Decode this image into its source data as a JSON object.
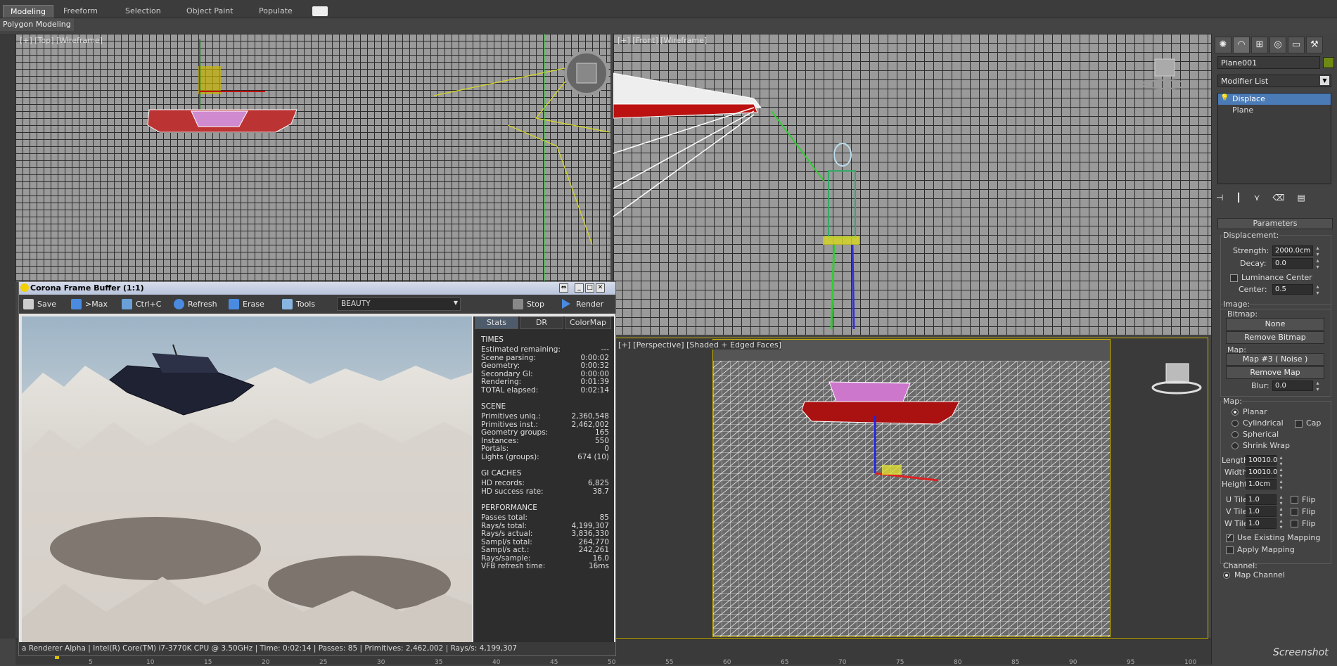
{
  "ribbon": {
    "tabs": [
      {
        "label": "Modeling"
      },
      {
        "label": "Freeform"
      },
      {
        "label": "Selection"
      },
      {
        "label": "Object Paint"
      },
      {
        "label": "Populate"
      }
    ],
    "subtab": "Polygon Modeling"
  },
  "viewports": {
    "top_label": "[+] [Top] [Wireframe]",
    "front_label": "[+] [Front] [Wireframe]",
    "persp_label": "[+] [Perspective] [Shaded + Edged Faces]",
    "viewcube_front": "FRONT",
    "viewcube_persp": "Front"
  },
  "command_panel": {
    "object_name": "Plane001",
    "object_color": "#6f8a12",
    "modifier_list": "Modifier List",
    "stack": [
      "Displace",
      "Plane"
    ],
    "rollout_title": "Parameters",
    "displacement": {
      "title": "Displacement:",
      "strength_label": "Strength:",
      "strength": "2000.0cm",
      "decay_label": "Decay:",
      "decay": "0.0",
      "luminance_center": "Luminance Center",
      "center_label": "Center:",
      "center": "0.5"
    },
    "image": {
      "title": "Image:",
      "bitmap_label": "Bitmap:",
      "bitmap_btn": "None",
      "remove_bitmap": "Remove Bitmap",
      "map_label": "Map:",
      "map_btn": "Map #3 ( Noise )",
      "remove_map": "Remove Map",
      "blur_label": "Blur:",
      "blur": "0.0"
    },
    "map": {
      "title": "Map:",
      "planar": "Planar",
      "cylindrical": "Cylindrical",
      "cap": "Cap",
      "spherical": "Spherical",
      "shrink_wrap": "Shrink Wrap",
      "length_label": "Length:",
      "length": "10010.0",
      "width_label": "Width:",
      "width": "10010.0",
      "height_label": "Height:",
      "height": "1.0cm",
      "utile_label": "U Tile:",
      "utile": "1.0",
      "vtile_label": "V Tile:",
      "vtile": "1.0",
      "wtile_label": "W Tile:",
      "wtile": "1.0",
      "flip": "Flip",
      "use_existing": "Use Existing Mapping",
      "apply_mapping": "Apply Mapping"
    },
    "channel": {
      "title": "Channel:",
      "map_channel": "Map Channel"
    }
  },
  "frame_buffer": {
    "title": "Corona Frame Buffer (1:1)",
    "toolbar": {
      "save": "Save",
      "max": ">Max",
      "ctrlc": "Ctrl+C",
      "refresh": "Refresh",
      "erase": "Erase",
      "tools": "Tools",
      "pass": "BEAUTY",
      "stop": "Stop",
      "render": "Render"
    },
    "stats_tabs": [
      "Stats",
      "DR",
      "ColorMap"
    ],
    "times": {
      "title": "TIMES",
      "rows": [
        {
          "k": "Estimated remaining:",
          "v": "---"
        },
        {
          "k": "Scene parsing:",
          "v": "0:00:02"
        },
        {
          "k": "Geometry:",
          "v": "0:00:32"
        },
        {
          "k": "Secondary GI:",
          "v": "0:00:00"
        },
        {
          "k": "Rendering:",
          "v": "0:01:39"
        },
        {
          "k": "TOTAL elapsed:",
          "v": "0:02:14"
        }
      ]
    },
    "scene": {
      "title": "SCENE",
      "rows": [
        {
          "k": "Primitives uniq.:",
          "v": "2,360,548"
        },
        {
          "k": "Primitives inst.:",
          "v": "2,462,002"
        },
        {
          "k": "Geometry groups:",
          "v": "165"
        },
        {
          "k": "Instances:",
          "v": "550"
        },
        {
          "k": "Portals:",
          "v": "0"
        },
        {
          "k": "Lights (groups):",
          "v": "674 (10)"
        }
      ]
    },
    "gi": {
      "title": "GI CACHES",
      "rows": [
        {
          "k": "HD records:",
          "v": "6,825"
        },
        {
          "k": "HD success rate:",
          "v": "38.7"
        }
      ]
    },
    "perf": {
      "title": "PERFORMANCE",
      "rows": [
        {
          "k": "Passes total:",
          "v": "85"
        },
        {
          "k": "Rays/s total:",
          "v": "4,199,307"
        },
        {
          "k": "Rays/s actual:",
          "v": "3,836,330"
        },
        {
          "k": "Sampl/s total:",
          "v": "264,770"
        },
        {
          "k": "Sampl/s act.:",
          "v": "242,261"
        },
        {
          "k": "Rays/sample:",
          "v": "16.0"
        },
        {
          "k": "VFB refresh time:",
          "v": "16ms"
        }
      ]
    },
    "status": "a Renderer Alpha | Intel(R) Core(TM) i7-3770K CPU @ 3.50GHz | Time: 0:02:14 | Passes: 85 | Primitives: 2,462,002 | Rays/s: 4,199,307"
  },
  "timeline": {
    "ticks": [
      "5",
      "10",
      "15",
      "20",
      "25",
      "30",
      "35",
      "40",
      "45",
      "50",
      "55",
      "60",
      "65",
      "70",
      "75",
      "80",
      "85",
      "90",
      "95",
      "100"
    ]
  },
  "watermark": "Screenshot"
}
